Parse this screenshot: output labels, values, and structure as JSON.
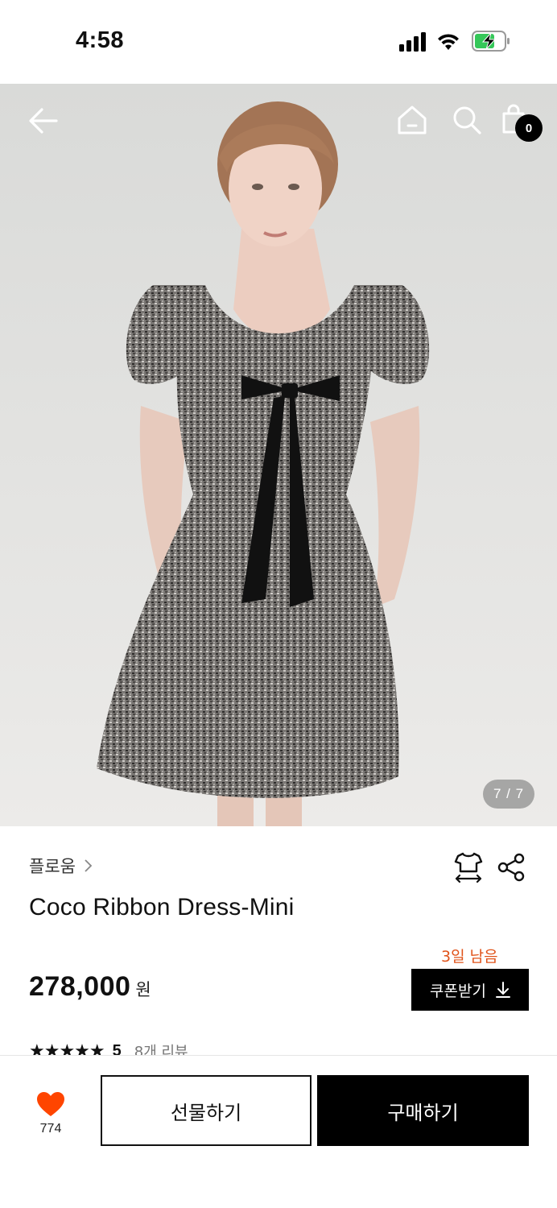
{
  "status_bar": {
    "time": "4:58"
  },
  "header": {
    "cart_count": "0"
  },
  "gallery": {
    "page_indicator": "7 / 7"
  },
  "product": {
    "brand": "플로움",
    "name": "Coco Ribbon Dress-Mini",
    "price": "278,000",
    "currency": "원",
    "coupon_note": "3일 남음",
    "coupon_label": "쿠폰받기",
    "stars": "★★★★★",
    "rating": "5",
    "review_count": "8개 리뷰"
  },
  "bottom_bar": {
    "like_count": "774",
    "gift_label": "선물하기",
    "buy_label": "구매하기"
  },
  "colors": {
    "accent_orange": "#e0531a",
    "heart": "#ff4500",
    "primary": "#000000"
  },
  "icons": [
    "back-arrow-icon",
    "home-icon",
    "search-icon",
    "shopping-bag-icon",
    "size-guide-icon",
    "share-icon",
    "download-icon",
    "heart-icon",
    "chevron-right-icon"
  ]
}
